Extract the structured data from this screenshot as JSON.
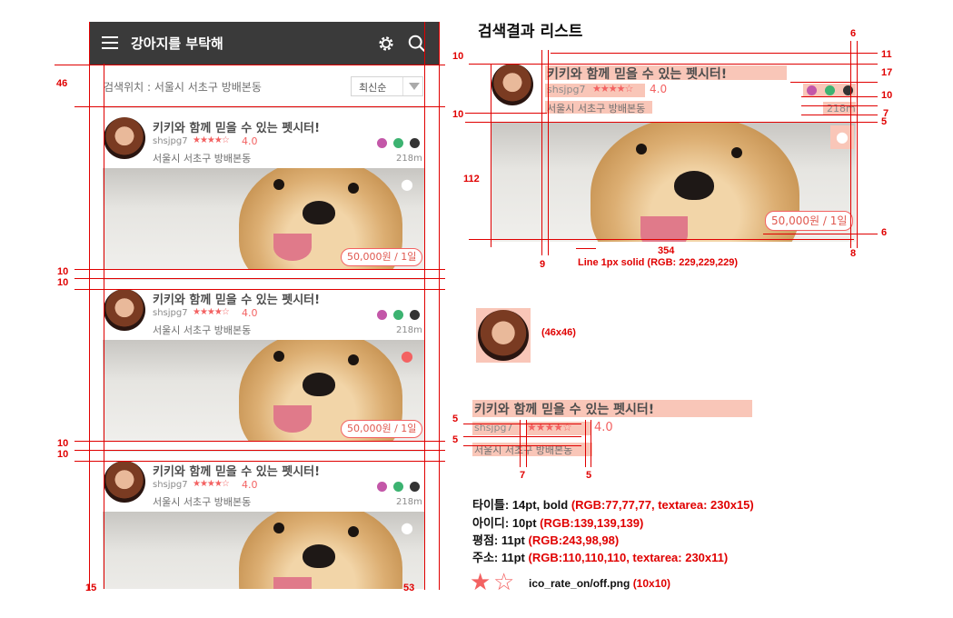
{
  "app": {
    "title": "강아지를 부탁해",
    "icons": [
      "menu-icon",
      "gear-icon",
      "search-icon"
    ]
  },
  "location": {
    "label": "검색위치 : 서울시 서초구 방배본동",
    "sort_value": "최신순"
  },
  "listing": {
    "title": "키키와 함께 믿을 수 있는 펫시터!",
    "user_id": "shsjpg7",
    "stars": "★★★★☆",
    "rating": "4.0",
    "address": "서울시 서초구 방배본동",
    "distance": "218m",
    "price": "50,000원 / 1일"
  },
  "spec": {
    "heading": "검색결과 리스트",
    "avatar_size": "(46x46)",
    "line_note": "Line 1px solid (RGB: 229,229,229)",
    "width_354": "354",
    "title_spec_label": "타이틀: ",
    "title_spec_font": "14pt, bold ",
    "title_spec_color": "(RGB:77,77,77,  textarea: 230x15)",
    "id_spec_label": "아이디: ",
    "id_spec_font": "10pt ",
    "id_spec_color": "(RGB:139,139,139)",
    "rate_spec_label": "평점: ",
    "rate_spec_font": "11pt ",
    "rate_spec_color": "(RGB:243,98,98)",
    "addr_spec_label": "주소: ",
    "addr_spec_font": "11pt ",
    "addr_spec_color": "(RGB:110,110,110,  textarea: 230x11)",
    "star_file": "ico_rate_on/off.png ",
    "star_size": "(10x10)",
    "star_on": "★",
    "star_off": "☆",
    "dims": {
      "d46": "46",
      "d15": "15",
      "d53": "53",
      "d10a": "10",
      "d10b": "10",
      "d10c": "10",
      "d10d": "10",
      "d10e": "10",
      "d10f": "10",
      "d10g": "10",
      "d6a": "6",
      "d11": "11",
      "d17": "17",
      "d7a": "7",
      "d5a": "5",
      "d112": "112",
      "d9": "9",
      "d8": "8",
      "d6b": "6",
      "d5b": "5",
      "d5c": "5",
      "d7b": "7",
      "d5d": "5"
    }
  },
  "colors": {
    "appbar": "#3a3a3a",
    "title": "#4d4d4d",
    "id": "#8b8b8b",
    "rating": "#f36262",
    "address": "#6e6e6e",
    "line": "#e5e5e5",
    "guide": "#e00000"
  }
}
